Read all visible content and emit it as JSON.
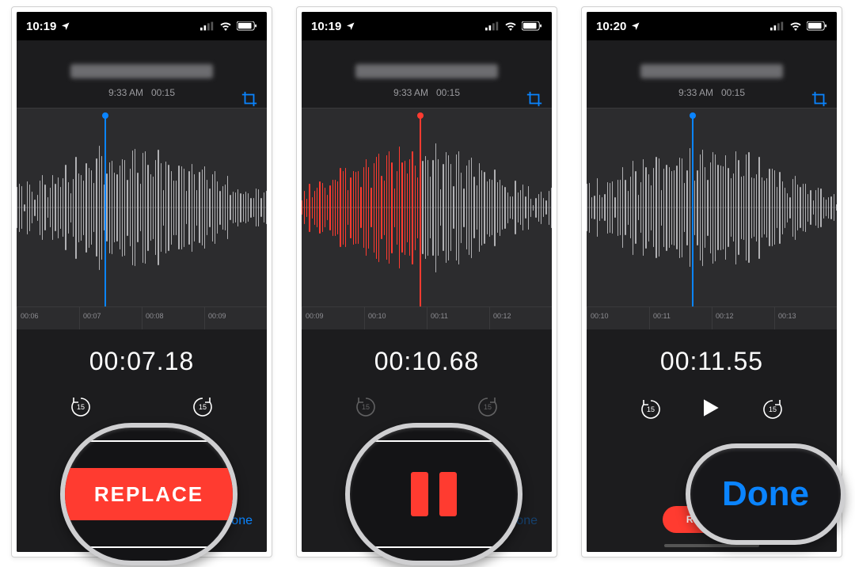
{
  "colors": {
    "accent_blue": "#0a84ff",
    "accent_red": "#ff3b30",
    "bg_dark": "#1c1c1e"
  },
  "callouts": {
    "replace_label": "REPLACE",
    "done_label": "Done"
  },
  "screens": [
    {
      "status_time": "10:19",
      "meta_time": "9:33 AM",
      "meta_duration": "00:15",
      "big_time": "00:07.18",
      "ticks": [
        "00:06",
        "00:07",
        "00:08",
        "00:09"
      ],
      "playhead_color": "blue",
      "playhead_pct": 35,
      "hot_waveform": false,
      "show_transport_play": false,
      "show_transport_pause": false,
      "show_replace_pill": true,
      "show_done": true,
      "replace_label": "REPLACE",
      "done_label": "Done",
      "skip_label": "15"
    },
    {
      "status_time": "10:19",
      "meta_time": "9:33 AM",
      "meta_duration": "00:15",
      "big_time": "00:10.68",
      "ticks": [
        "00:09",
        "00:10",
        "00:11",
        "00:12"
      ],
      "playhead_color": "red",
      "playhead_pct": 47,
      "hot_waveform": true,
      "show_transport_play": false,
      "show_transport_pause": true,
      "show_replace_pill": false,
      "show_done": true,
      "done_label": "Done",
      "skip_label": "15"
    },
    {
      "status_time": "10:20",
      "meta_time": "9:33 AM",
      "meta_duration": "00:15",
      "big_time": "00:11.55",
      "ticks": [
        "00:10",
        "00:11",
        "00:12",
        "00:13"
      ],
      "playhead_color": "blue",
      "playhead_pct": 42,
      "hot_waveform": false,
      "show_transport_play": true,
      "show_transport_pause": false,
      "show_replace_pill": true,
      "show_done": true,
      "replace_label": "REPLACE",
      "done_label": "Done",
      "skip_label": "15"
    }
  ]
}
